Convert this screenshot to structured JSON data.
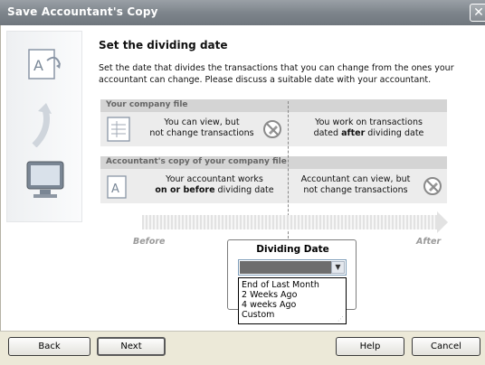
{
  "window": {
    "title": "Save Accountant's Copy",
    "close_glyph": "✕"
  },
  "page": {
    "heading": "Set the dividing date",
    "description": "Set the date that divides the transactions that you can change from the ones your accountant can change. Please discuss a suitable date with your accountant."
  },
  "company_file": {
    "header": "Your company file",
    "left_line1": "You can view, but",
    "left_line2": "not change transactions",
    "right_line1": "You work on transactions",
    "right_line2_pre": "dated ",
    "right_line2_bold": "after",
    "right_line2_post": " dividing date"
  },
  "accountant_copy": {
    "header": "Accountant's copy of your company file",
    "left_line1": "Your accountant works",
    "left_line2_bold": "on or before",
    "left_line2_post": " dividing date",
    "right_line1": "Accountant can view, but",
    "right_line2": "not change transactions"
  },
  "timeline": {
    "before_label": "Before",
    "after_label": "After"
  },
  "dividing_date": {
    "title": "Dividing Date",
    "selected_value": "",
    "options": [
      "End of Last Month",
      "2 Weeks Ago",
      "4 weeks Ago",
      "Custom"
    ]
  },
  "buttons": {
    "back": "Back",
    "next": "Next",
    "help": "Help",
    "cancel": "Cancel"
  },
  "icons": {
    "side": [
      "edit-document-icon",
      "curved-arrow-icon",
      "monitor-icon"
    ],
    "company_file": "register-icon",
    "accountant_copy": "document-a-icon",
    "no_edit": "no-edit-icon"
  },
  "colors": {
    "titlebar": "#7e858c",
    "section_band": "#d4d4d4",
    "section_row": "#ececec",
    "dropdown_selected": "#6d6d6d"
  }
}
